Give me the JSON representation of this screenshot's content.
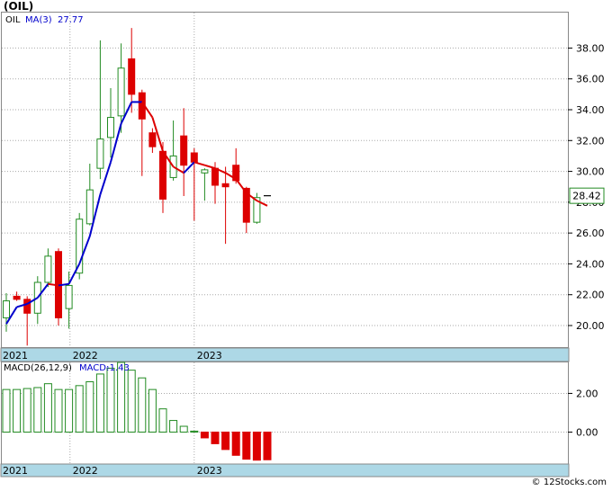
{
  "title": "(OIL)",
  "footer": "© 12Stocks.com",
  "colors": {
    "up": "#228B22",
    "down": "#dd0000",
    "ma": "#0000cc",
    "band": "#add8e6",
    "grid": "#999999"
  },
  "chart_data": [
    {
      "type": "candlestick",
      "title": "",
      "legend": {
        "symbol": "OIL",
        "ma_label": "MA(3)",
        "ma_value": "27.77"
      },
      "last_price": "28.42",
      "ylim": [
        18.6,
        40.3
      ],
      "yticks": [
        "20.00",
        "22.00",
        "24.00",
        "26.00",
        "28.00",
        "30.00",
        "32.00",
        "34.00",
        "36.00",
        "38.00"
      ],
      "xticks": [
        {
          "label": "2021",
          "index": -0.7
        },
        {
          "label": "2022",
          "index": 6.1
        },
        {
          "label": "2023",
          "index": 18.0
        }
      ],
      "candles": [
        {
          "o": 20.5,
          "h": 22.1,
          "l": 19.6,
          "c": 21.6
        },
        {
          "o": 21.9,
          "h": 22.2,
          "l": 21.6,
          "c": 21.7
        },
        {
          "o": 21.7,
          "h": 21.9,
          "l": 18.7,
          "c": 20.8
        },
        {
          "o": 20.8,
          "h": 23.2,
          "l": 20.1,
          "c": 22.8
        },
        {
          "o": 22.8,
          "h": 25.0,
          "l": 22.5,
          "c": 24.5
        },
        {
          "o": 24.8,
          "h": 25.0,
          "l": 20.0,
          "c": 20.5
        },
        {
          "o": 21.1,
          "h": 23.5,
          "l": 19.8,
          "c": 22.6
        },
        {
          "o": 23.4,
          "h": 27.3,
          "l": 23.0,
          "c": 26.9
        },
        {
          "o": 26.6,
          "h": 30.5,
          "l": 26.5,
          "c": 28.8
        },
        {
          "o": 30.2,
          "h": 38.5,
          "l": 29.5,
          "c": 32.1
        },
        {
          "o": 32.2,
          "h": 35.4,
          "l": 30.9,
          "c": 33.5
        },
        {
          "o": 33.6,
          "h": 38.3,
          "l": 32.5,
          "c": 36.7
        },
        {
          "o": 37.3,
          "h": 39.3,
          "l": 33.8,
          "c": 35.0
        },
        {
          "o": 35.1,
          "h": 35.3,
          "l": 29.7,
          "c": 33.4
        },
        {
          "o": 32.5,
          "h": 32.8,
          "l": 31.2,
          "c": 31.6
        },
        {
          "o": 31.3,
          "h": 31.9,
          "l": 27.3,
          "c": 28.2
        },
        {
          "o": 29.6,
          "h": 33.3,
          "l": 29.4,
          "c": 31.0
        },
        {
          "o": 32.3,
          "h": 34.1,
          "l": 28.4,
          "c": 30.4
        },
        {
          "o": 31.2,
          "h": 31.5,
          "l": 26.8,
          "c": 30.6
        },
        {
          "o": 29.9,
          "h": 30.2,
          "l": 28.1,
          "c": 30.1
        },
        {
          "o": 30.2,
          "h": 30.6,
          "l": 27.9,
          "c": 29.1
        },
        {
          "o": 29.2,
          "h": 30.3,
          "l": 25.3,
          "c": 29.0
        },
        {
          "o": 30.4,
          "h": 31.5,
          "l": 29.2,
          "c": 29.4
        },
        {
          "o": 28.9,
          "h": 29.0,
          "l": 26.0,
          "c": 26.7
        },
        {
          "o": 26.7,
          "h": 28.6,
          "l": 26.6,
          "c": 28.3
        },
        {
          "o": 28.42,
          "h": 28.42,
          "l": 28.42,
          "c": 28.42
        }
      ],
      "ma": [
        20.1,
        21.2,
        21.4,
        21.8,
        22.7,
        22.6,
        22.7,
        24.0,
        25.8,
        28.5,
        30.6,
        33.1,
        34.5,
        34.5,
        33.5,
        31.3,
        30.3,
        29.9,
        30.6,
        30.4,
        30.2,
        29.9,
        29.5,
        28.6,
        28.1,
        27.77
      ]
    },
    {
      "type": "bar",
      "title": "",
      "legend": {
        "params": "MACD(26,12,9)",
        "macd_label": "MACD:",
        "macd_value": "-1.43"
      },
      "ylim": [
        -1.65,
        3.6
      ],
      "yticks": [
        "0.00",
        "2.00"
      ],
      "xticks": [
        {
          "label": "2021",
          "index": -0.7
        },
        {
          "label": "2022",
          "index": 6.1
        },
        {
          "label": "2023",
          "index": 18.0
        }
      ],
      "values": [
        2.2,
        2.2,
        2.25,
        2.3,
        2.5,
        2.2,
        2.2,
        2.4,
        2.6,
        3.0,
        3.3,
        3.6,
        3.2,
        2.8,
        2.2,
        1.2,
        0.6,
        0.3,
        0.05,
        -0.3,
        -0.6,
        -0.9,
        -1.2,
        -1.4,
        -1.45,
        -1.43
      ]
    }
  ]
}
